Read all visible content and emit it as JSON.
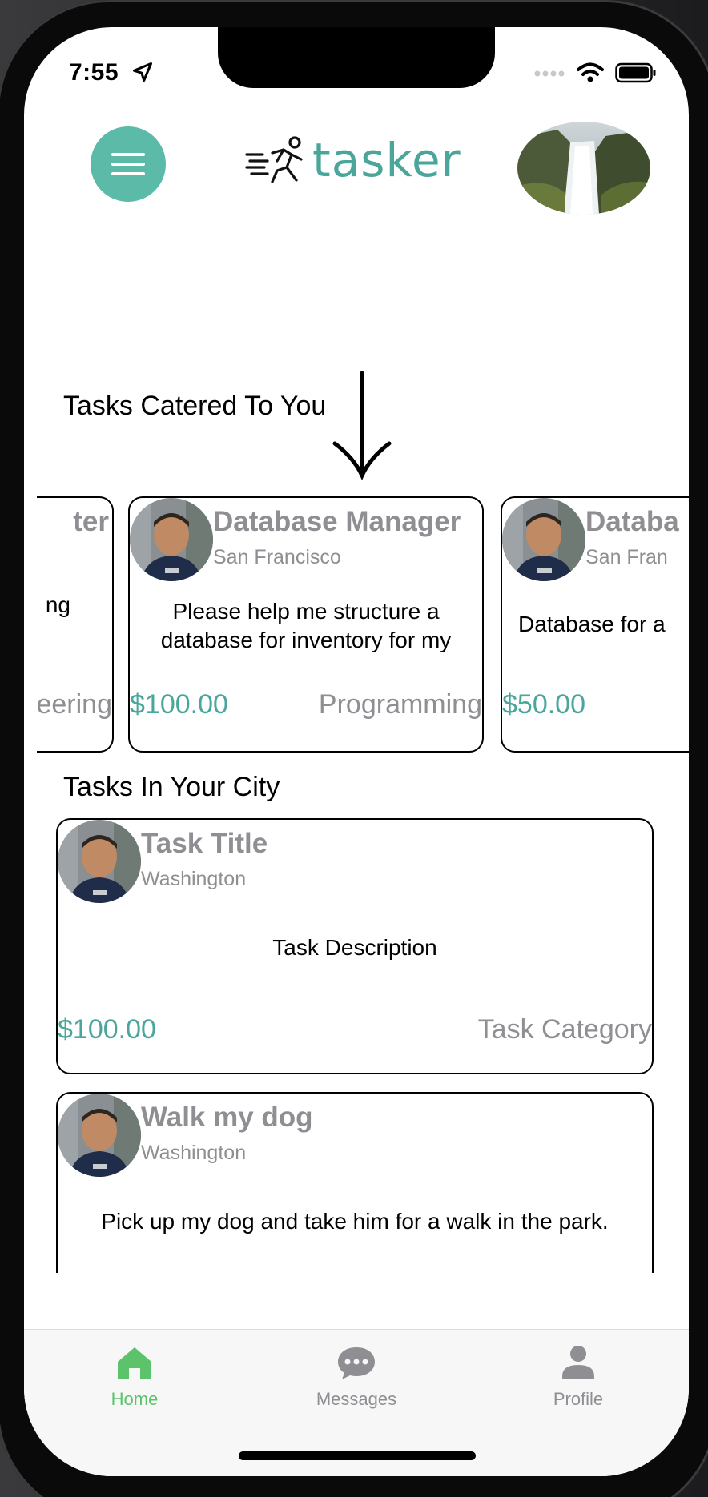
{
  "status_bar": {
    "time": "7:55"
  },
  "header": {
    "logo_text": "tasker",
    "menu_icon": "hamburger-icon",
    "avatar_icon": "waterfall-profile-image"
  },
  "sections": {
    "catered_title": "Tasks Catered To You",
    "city_title": "Tasks In Your City"
  },
  "catered_cards": [
    {
      "title_fragment": "ter",
      "desc_fragment": "ng",
      "category_fragment": "eering"
    },
    {
      "title": "Database Manager",
      "city": "San Francisco",
      "description": "Please help me structure a database for inventory for my",
      "price": "$100.00",
      "category": "Programming"
    },
    {
      "title": "Databa",
      "city": "San Fran",
      "description": "Database for a",
      "price": "$50.00"
    }
  ],
  "city_cards": [
    {
      "title": "Task Title",
      "city": "Washington",
      "description": "Task Description",
      "price": "$100.00",
      "category": "Task Category"
    },
    {
      "title": "Walk my dog",
      "city": "Washington",
      "description": "Pick up my dog and take him for a walk in the park."
    }
  ],
  "tabbar": {
    "items": [
      {
        "label": "Home",
        "icon": "home-icon",
        "active": true
      },
      {
        "label": "Messages",
        "icon": "chat-bubble-icon",
        "active": false
      },
      {
        "label": "Profile",
        "icon": "person-icon",
        "active": false
      }
    ]
  },
  "colors": {
    "accent": "#4aa69a",
    "menu_button": "#5bbaa8",
    "active_tab": "#5cc36a",
    "inactive_tab": "#8e8e93",
    "muted_text": "#8e8e93"
  }
}
